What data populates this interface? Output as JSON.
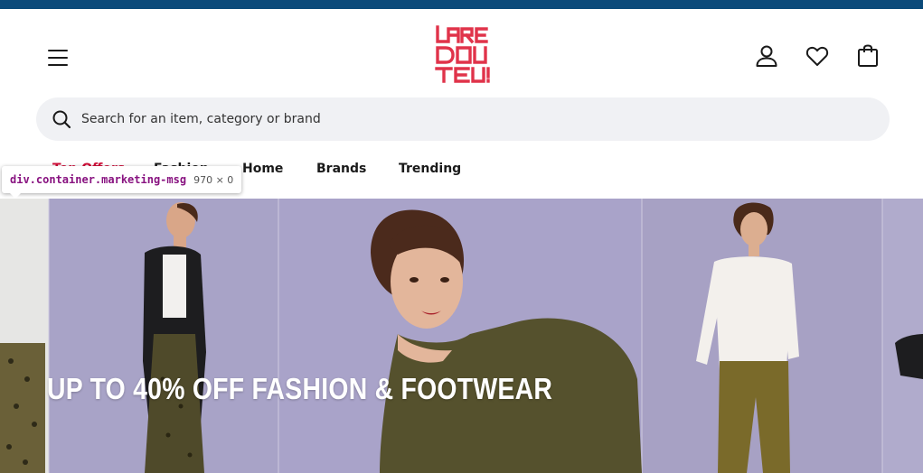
{
  "header": {
    "logo_text": "LA REDOUTE",
    "menu_icon": "hamburger-menu-icon",
    "account_icon": "user-icon",
    "wishlist_icon": "heart-icon",
    "bag_icon": "shopping-bag-icon"
  },
  "search": {
    "placeholder": "Search for an item, category or brand",
    "icon": "search-icon"
  },
  "nav": {
    "items": [
      {
        "label": "Top Offers"
      },
      {
        "label": "Fashion"
      },
      {
        "label": "Home"
      },
      {
        "label": "Brands"
      },
      {
        "label": "Trending"
      }
    ]
  },
  "devtools_tooltip": {
    "selector": "div.container.marketing-msg",
    "size": "970 × 0"
  },
  "hero": {
    "title": "UP TO 40% OFF FASHION & FOOTWEAR"
  },
  "colors": {
    "topbar": "#0b4a7a",
    "brand": "#e0334a",
    "promo": "#d1103a",
    "hero_bg": "#a8a2c6"
  }
}
